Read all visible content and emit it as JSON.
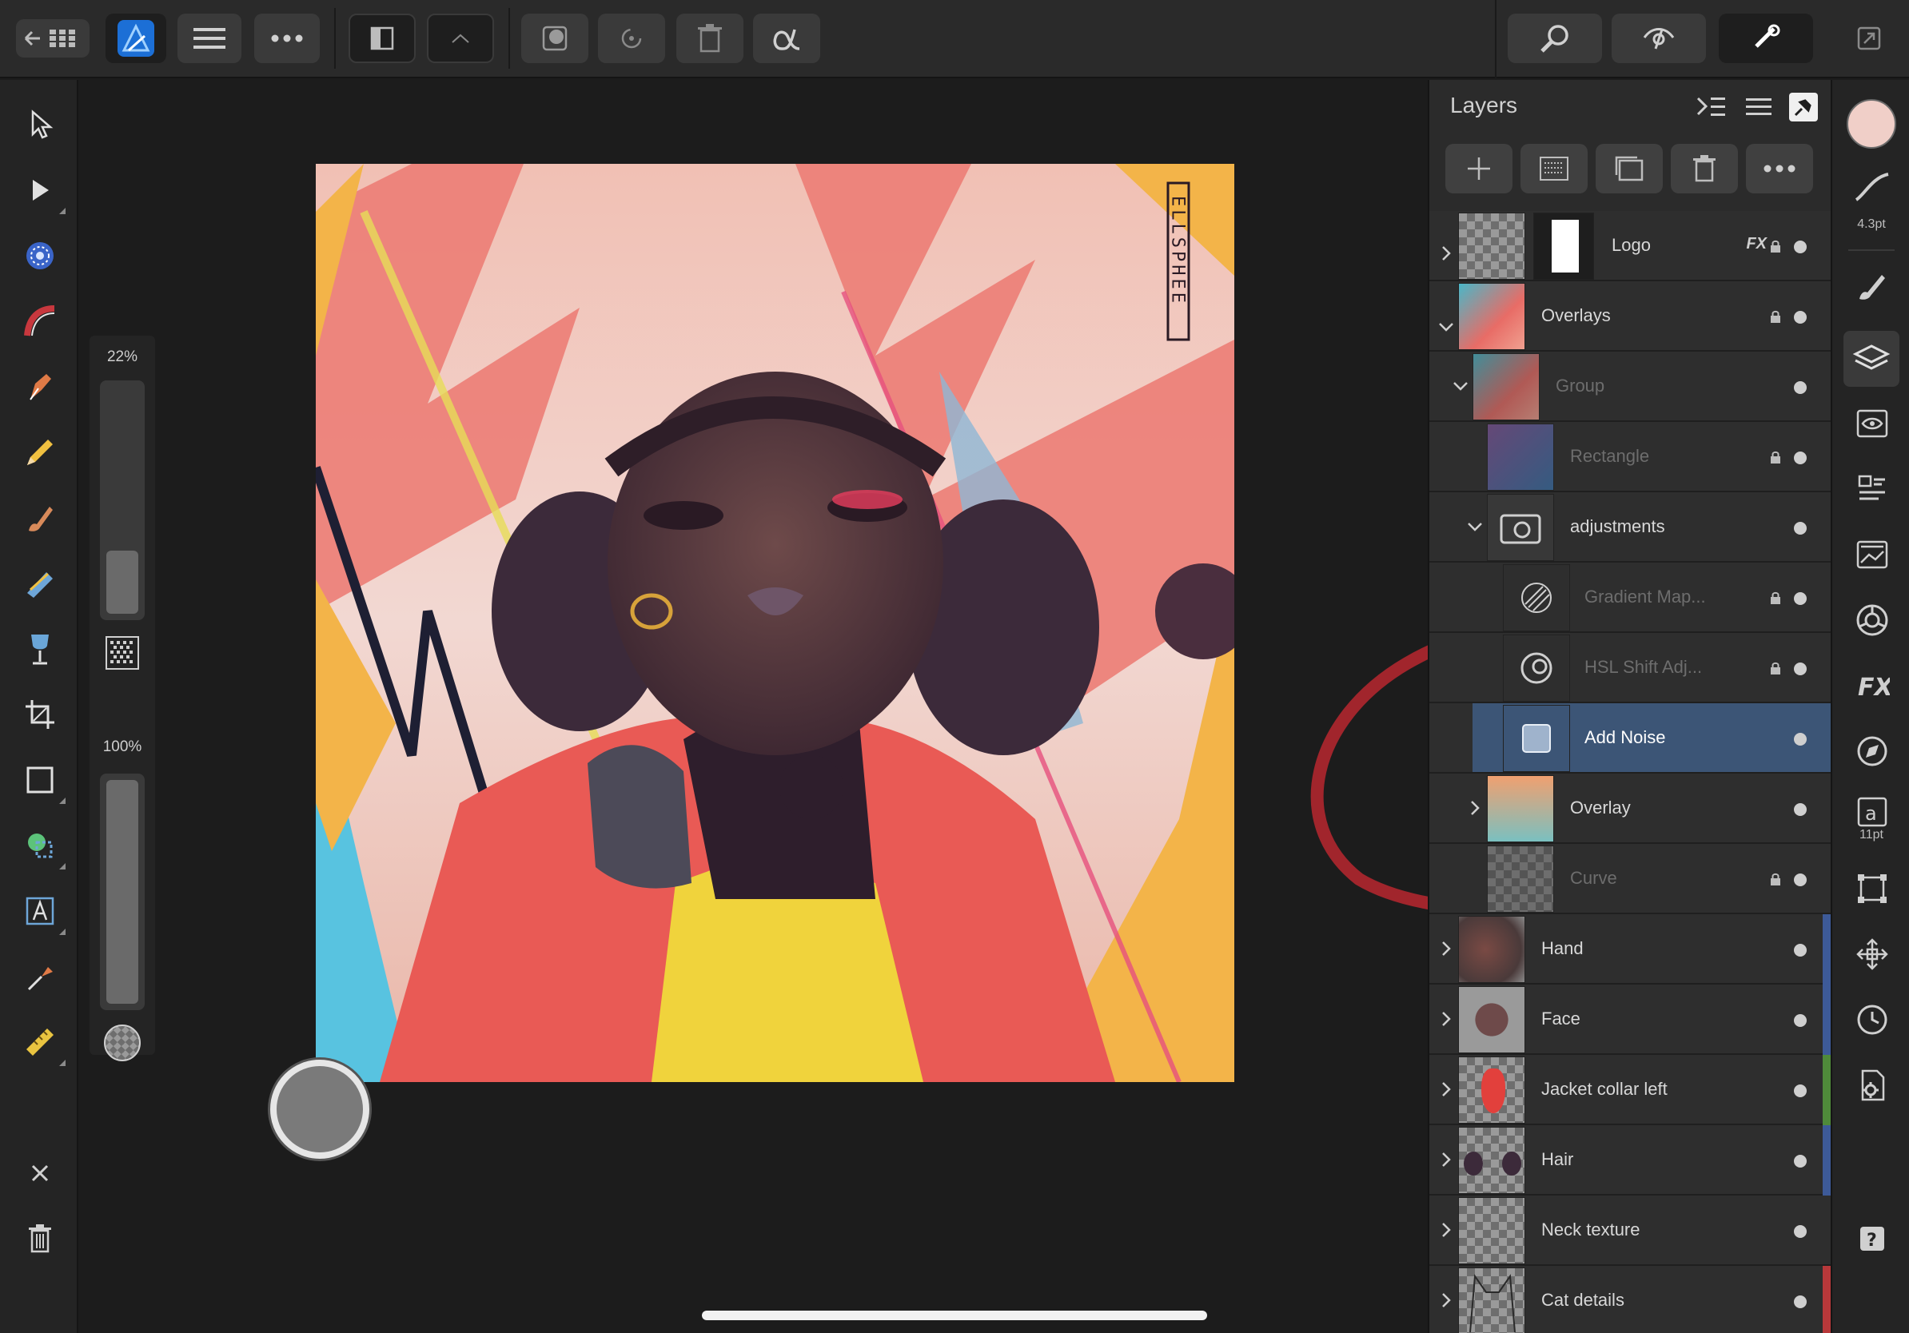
{
  "sliders": {
    "size_label": "22%",
    "size_value": 0.22,
    "opacity_label": "100%",
    "opacity_value": 1.0
  },
  "canvas": {
    "signature_text": "ELLSPHEE"
  },
  "layers_panel": {
    "title": "Layers",
    "layers": [
      {
        "name": "Logo",
        "fx": "FX",
        "locked": true,
        "dim": false,
        "color": "",
        "thumb": "logo"
      },
      {
        "name": "Overlays",
        "locked": true,
        "dim": false,
        "color": "",
        "thumb": "overlays"
      },
      {
        "name": "Group",
        "locked": false,
        "dim": true,
        "color": "",
        "thumb": "group"
      },
      {
        "name": "Rectangle",
        "locked": true,
        "dim": true,
        "color": "",
        "thumb": "rectangle"
      },
      {
        "name": "adjustments",
        "locked": false,
        "dim": false,
        "color": "",
        "thumb": "adjustments"
      },
      {
        "name": "Gradient Map...",
        "locked": true,
        "dim": true,
        "color": "",
        "thumb": "gradient-map"
      },
      {
        "name": "HSL Shift Adj...",
        "locked": true,
        "dim": true,
        "color": "",
        "thumb": "hsl"
      },
      {
        "name": "Add Noise",
        "locked": false,
        "dim": false,
        "color": "",
        "thumb": "noise",
        "selected": true
      },
      {
        "name": "Overlay",
        "locked": false,
        "dim": false,
        "color": "",
        "thumb": "overlay"
      },
      {
        "name": "Curve",
        "locked": true,
        "dim": true,
        "color": "",
        "thumb": "curve"
      },
      {
        "name": "Hand",
        "locked": false,
        "dim": false,
        "color": "#3d5a98",
        "thumb": "hand"
      },
      {
        "name": "Face",
        "locked": false,
        "dim": false,
        "color": "#3d5a98",
        "thumb": "face"
      },
      {
        "name": "Jacket collar left",
        "locked": false,
        "dim": false,
        "color": "#4f8a3a",
        "thumb": "jacket"
      },
      {
        "name": "Hair",
        "locked": false,
        "dim": false,
        "color": "#3d5a98",
        "thumb": "hair"
      },
      {
        "name": "Neck texture",
        "locked": false,
        "dim": false,
        "color": "",
        "thumb": "neck"
      },
      {
        "name": "Cat details",
        "locked": false,
        "dim": false,
        "color": "#b8383a",
        "thumb": "cat"
      }
    ]
  },
  "studio": {
    "brush_size_label": "4.3pt",
    "text_size_label": "11pt",
    "color_swatch": "#f0cfc8"
  },
  "colors": {
    "accent_selected": "#3c5576",
    "annotation": "#b8272f"
  }
}
